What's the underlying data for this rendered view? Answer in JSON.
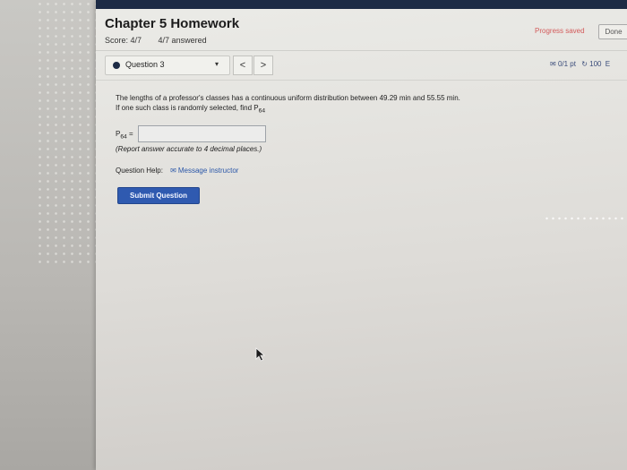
{
  "header": {
    "title": "Chapter 5 Homework",
    "score": "Score: 4/7",
    "answered": "4/7 answered",
    "progress": "Progress saved",
    "done_label": "Done"
  },
  "question_nav": {
    "selected_question": "Question 3",
    "caret": "▾",
    "prev": "<",
    "next": ">",
    "points": "0/1 pt",
    "retries": "100",
    "retries_tail": "E"
  },
  "question": {
    "line1": "The lengths of a professor's classes has a continuous uniform distribution between 49.29 min and 55.55 min.",
    "line2_prefix": "If one such class is randomly selected, find P",
    "line2_sub": "64",
    "answer_label": "P",
    "answer_sub": "64",
    "answer_eq": " =",
    "answer_value": "",
    "hint": "(Report answer accurate to 4 decimal places.)",
    "help_label": "Question Help:",
    "message_link": "Message instructor",
    "submit_label": "Submit Question"
  },
  "icons": {
    "points_icon": "✉",
    "retry_icon": "↻",
    "mail_icon": "✉"
  }
}
